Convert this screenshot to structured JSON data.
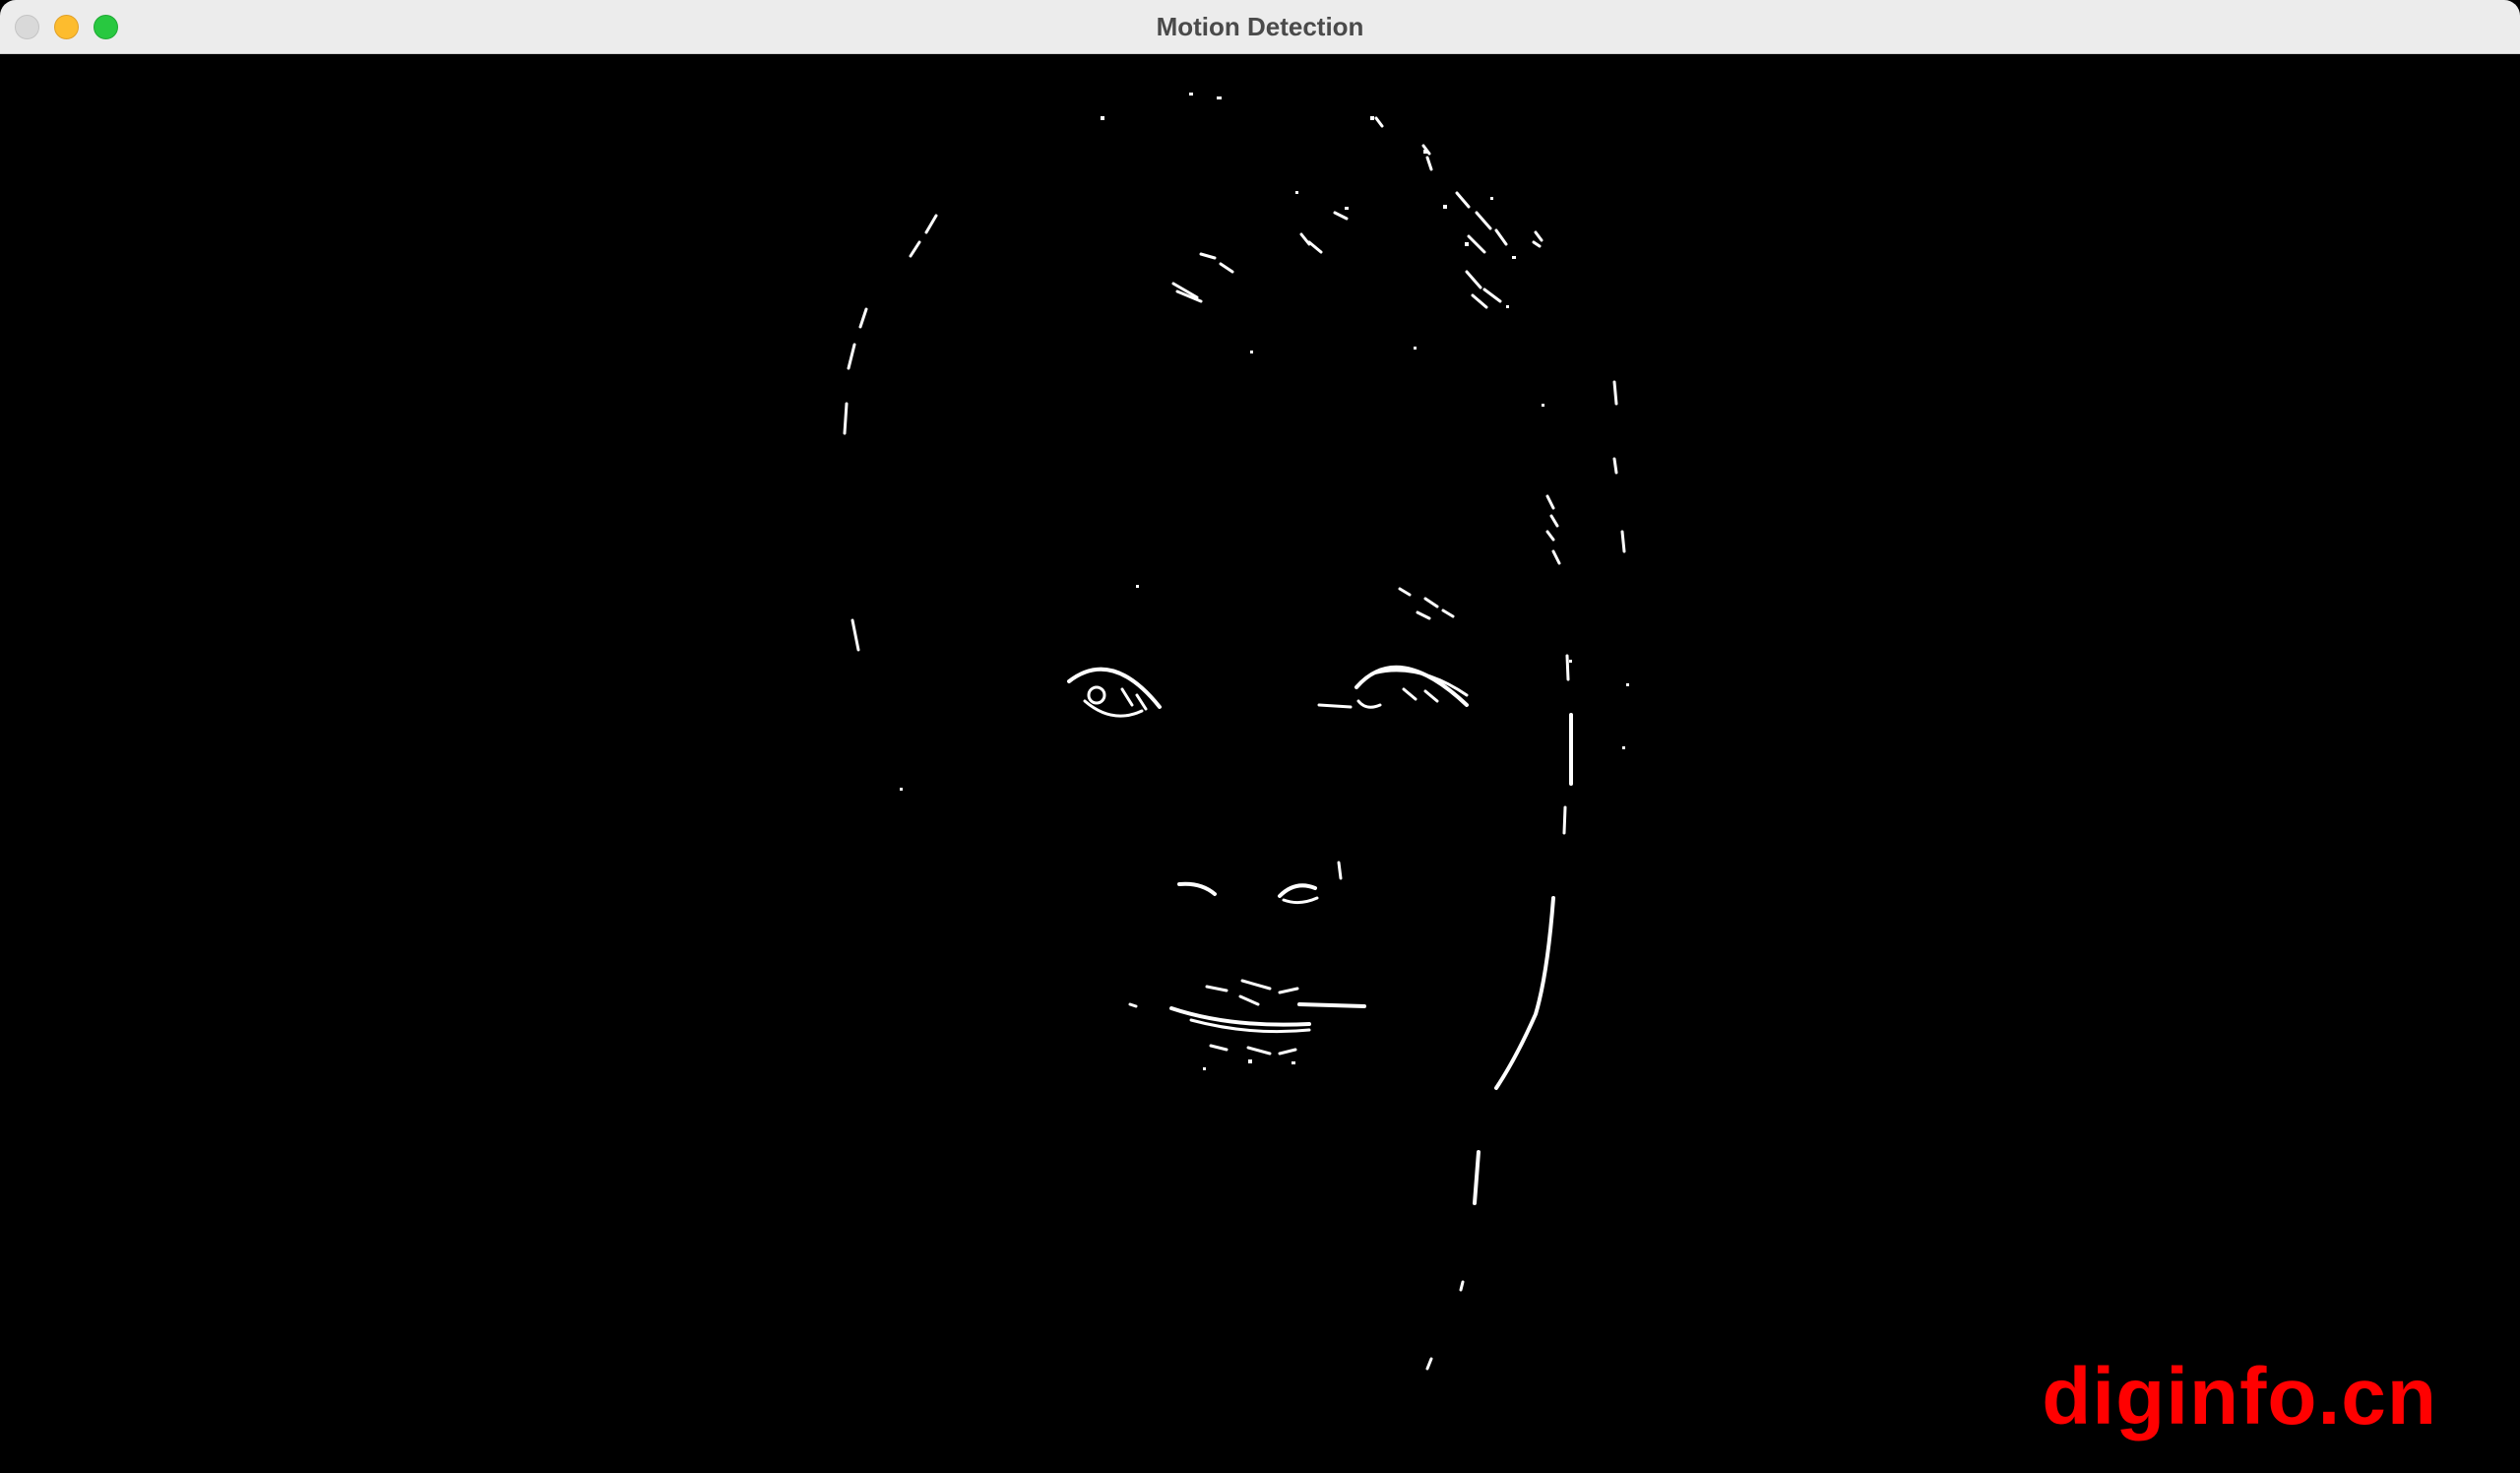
{
  "window": {
    "title": "Motion Detection"
  },
  "controls": {
    "close_icon": "close-icon",
    "minimize_icon": "minimize-icon",
    "zoom_icon": "zoom-icon"
  },
  "video": {
    "background_color": "#000000",
    "edge_color": "#ffffff"
  },
  "watermark": {
    "text": "diginfo.cn",
    "color": "#ff0000"
  }
}
